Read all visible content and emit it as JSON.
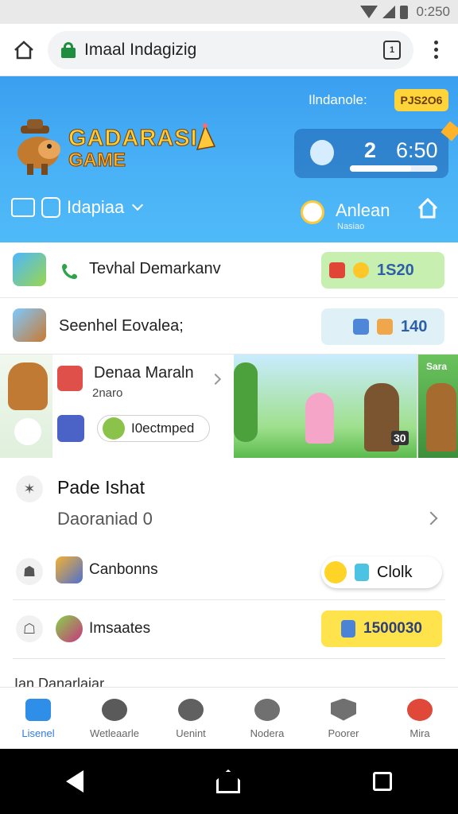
{
  "status_bar": {
    "time": "0:250"
  },
  "browser": {
    "url": "Imaal Indagizig"
  },
  "banner": {
    "top_label": "Ilndanole:",
    "coin_badge": "PJS2O6",
    "logo_line1": "GADARASI",
    "logo_line2": "GAME",
    "stats_num": "2",
    "stats_val": "6:50",
    "stats_progress": 0.7,
    "nav_label": "Idapiaa",
    "alarm_label": "Anlean",
    "alarm_sub": "Nasiao"
  },
  "rows": [
    {
      "label": "Tevhal Demarkanv",
      "pill_value": "1S20",
      "pill_color": "#c6efb0"
    },
    {
      "label": "Seenhel Eovalea;",
      "pill_value": "140",
      "pill_color": "#dff1f6"
    }
  ],
  "promo": {
    "title": "Denaa Maraln",
    "subtitle": "2naro",
    "button_label": "I0ectmped",
    "scene_badge": "30",
    "scene2_label": "Sara"
  },
  "section": {
    "title": "Pade Ishat",
    "subtitle": "Daoraniad 0",
    "rows": [
      {
        "label": "Canbonns",
        "action": "Clolk"
      },
      {
        "label": "Imsaates",
        "action": "1500030"
      }
    ],
    "cut_label": "Ian Danarlaiar"
  },
  "tabs": [
    {
      "label": "Lisenel",
      "active": true,
      "color": "#2f8ee8"
    },
    {
      "label": "Wetleaarle",
      "active": false,
      "color": "#5a5a5a"
    },
    {
      "label": "Uenint",
      "active": false,
      "color": "#606060"
    },
    {
      "label": "Nodera",
      "active": false,
      "color": "#707070"
    },
    {
      "label": "Poorer",
      "active": false,
      "color": "#707070"
    },
    {
      "label": "Mira",
      "active": false,
      "color": "#e0483a"
    }
  ]
}
